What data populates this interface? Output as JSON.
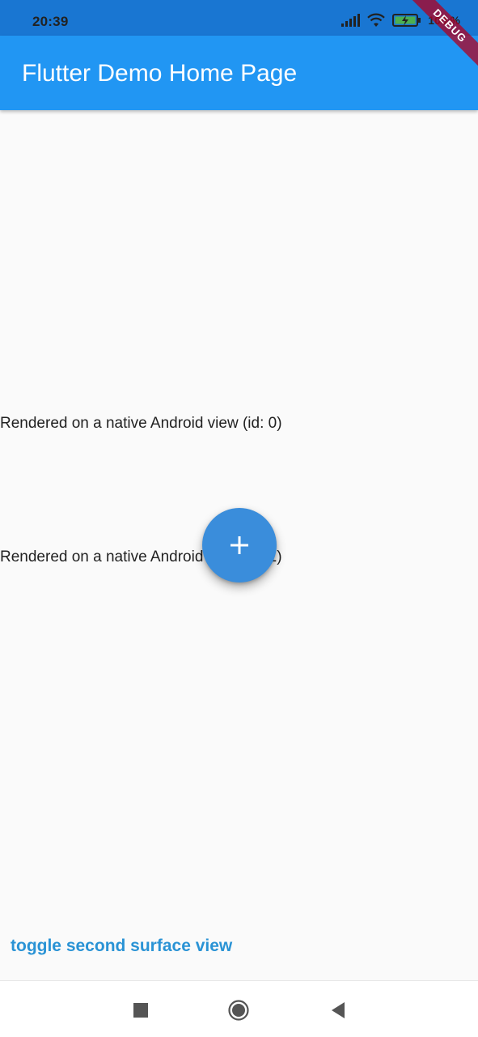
{
  "status_bar": {
    "time": "20:39",
    "battery_pct": "100 %",
    "icons": [
      "signal-icon",
      "wifi-icon",
      "battery-charging-icon"
    ]
  },
  "debug_banner": "DEBUG",
  "app_bar": {
    "title": "Flutter Demo Home Page",
    "color": "#2196F3"
  },
  "content": {
    "native_views": [
      {
        "label": "Rendered on a native Android view (id: 0)"
      },
      {
        "label": "Rendered on a native Android view (id: 1)"
      }
    ]
  },
  "fab": {
    "icon": "plus-icon",
    "color": "#3A8DDB"
  },
  "footer": {
    "toggle_label": "toggle second surface view",
    "color": "#2A93D5"
  },
  "nav_bar": {
    "items": [
      "recents-icon",
      "home-icon",
      "back-icon"
    ]
  }
}
